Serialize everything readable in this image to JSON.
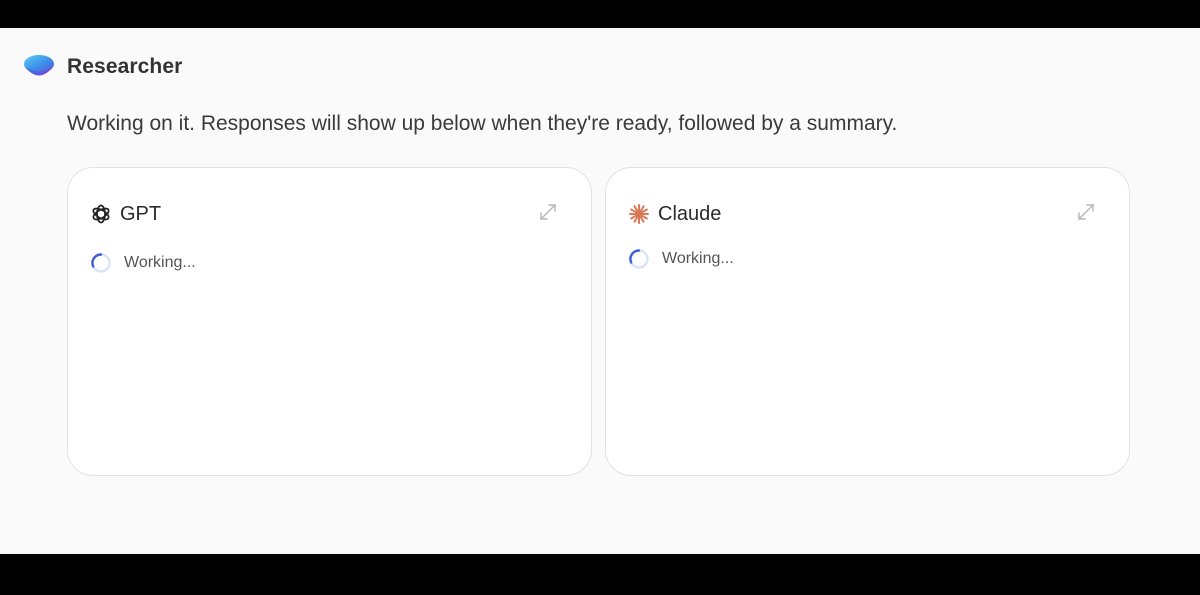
{
  "app": {
    "title": "Researcher",
    "logo_icon": "researcher-logo"
  },
  "status_message": "Working on it. Responses will show up below when they're ready, followed by a summary.",
  "models": [
    {
      "name": "GPT",
      "icon": "openai-icon",
      "status": "Working...",
      "expand_icon": "expand-icon"
    },
    {
      "name": "Claude",
      "icon": "claude-sparkle-icon",
      "status": "Working...",
      "expand_icon": "expand-icon",
      "accent_color": "#d97757"
    }
  ],
  "colors": {
    "background": "#fafafa",
    "spinner_track": "#dbe3fb",
    "spinner_arc": "#3f5ed8"
  }
}
